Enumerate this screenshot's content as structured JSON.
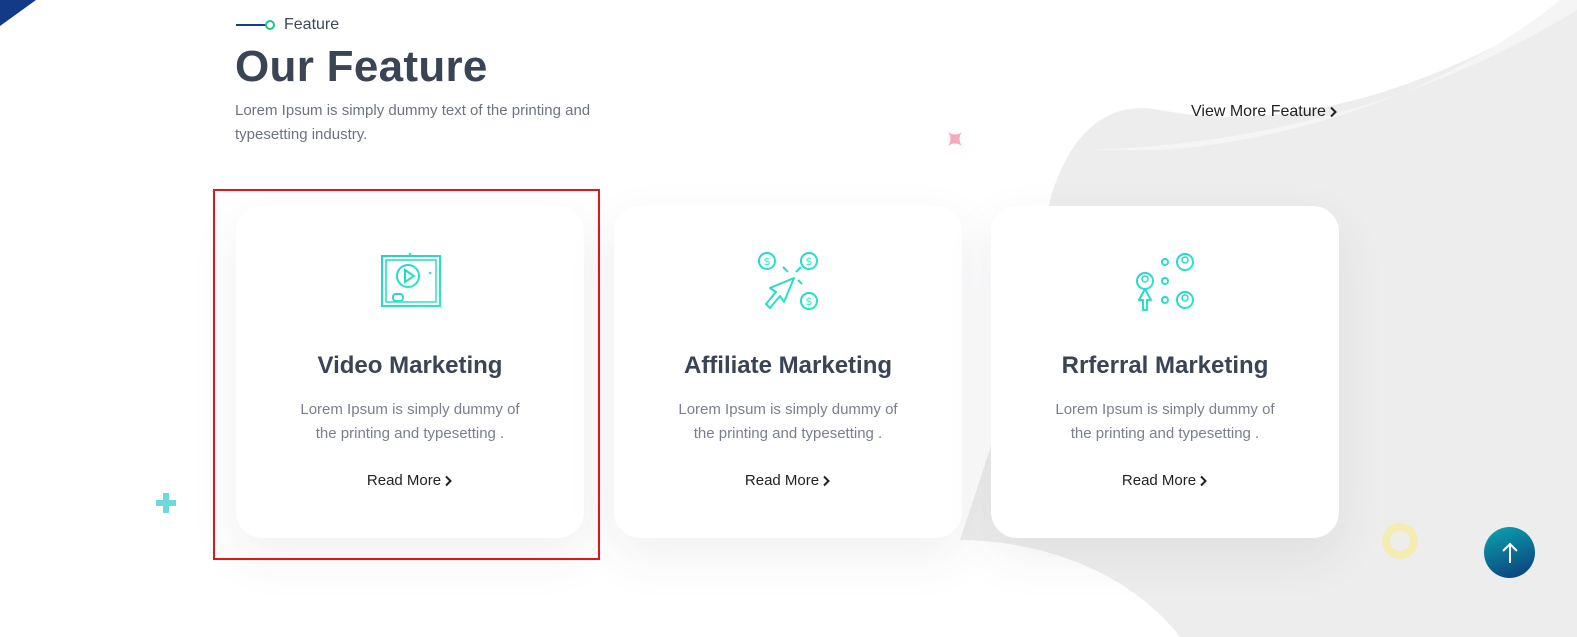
{
  "section": {
    "tag": "Feature",
    "title": "Our Feature",
    "subtitle": "Lorem Ipsum is simply dummy text of the printing and typesetting industry.",
    "view_more": "View More Feature"
  },
  "cards": [
    {
      "icon": "video-play-icon",
      "title": "Video Marketing",
      "description": "Lorem Ipsum is simply dummy of the printing and typesetting .",
      "link": "Read More"
    },
    {
      "icon": "cursor-dollar-icon",
      "title": "Affiliate Marketing",
      "description": "Lorem Ipsum is simply dummy of the printing and typesetting .",
      "link": "Read More"
    },
    {
      "icon": "referral-network-icon",
      "title": "Rrferral Marketing",
      "description": "Lorem Ipsum is simply dummy of the printing and typesetting .",
      "link": "Read More"
    }
  ],
  "icons": {
    "chevron": "chevron-right-icon",
    "scroll_top": "arrow-up-icon"
  },
  "colors": {
    "accent_teal": "#2ee8c0",
    "navy": "#163c8a",
    "green_dot": "#22c38e",
    "highlight_red": "#e3151a",
    "to_top_gradient_start": "#0aa6b0",
    "to_top_gradient_end": "#0c3a78"
  }
}
